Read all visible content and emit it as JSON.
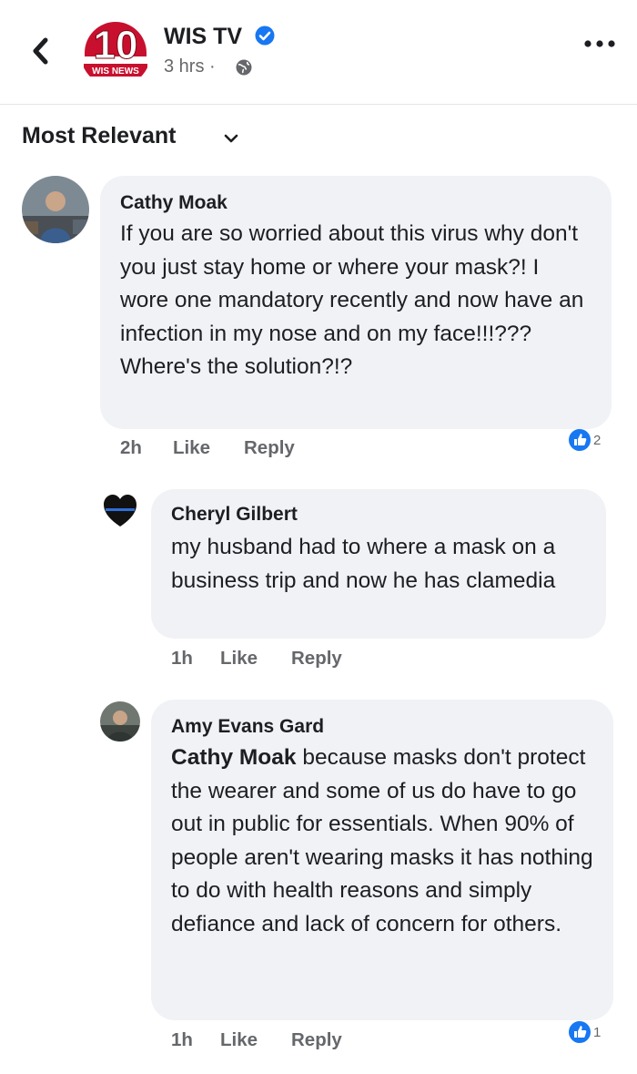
{
  "header": {
    "page_name": "WIS TV",
    "time": "3 hrs ·",
    "logo_text": "10",
    "logo_subtext": "WIS NEWS"
  },
  "sort": {
    "label": "Most Relevant"
  },
  "comments": [
    {
      "author": "Cathy Moak",
      "text": "If you are so worried about this virus why don't you just stay home or where your mask?! I wore one mandatory recently and now have an infection in my nose and on my face!!!??? Where's the solution?!?",
      "time": "2h",
      "like": "Like",
      "reply": "Reply",
      "reaction_count": "2"
    },
    {
      "author": "Cheryl Gilbert",
      "text": "my husband had to where a mask on a business trip and now he has clamedia",
      "time": "1h",
      "like": "Like",
      "reply": "Reply"
    },
    {
      "author": "Amy Evans Gard",
      "mention": "Cathy Moak",
      "text": " because masks don't protect the wearer and some of us do have to go out in public for essentials. When 90% of people aren't wearing masks it has nothing to do with health reasons and simply defiance and lack of concern for others.",
      "time": "1h",
      "like": "Like",
      "reply": "Reply",
      "reaction_count": "1"
    }
  ],
  "colors": {
    "brand_blue": "#1877f2",
    "bubble_bg": "#f0f2f5",
    "meta_gray": "#65676b",
    "logo_red": "#c8102e"
  },
  "icons": [
    "back-chevron-icon",
    "verified-badge-icon",
    "globe-icon",
    "more-options-icon",
    "chevron-down-icon",
    "like-reaction-icon"
  ]
}
